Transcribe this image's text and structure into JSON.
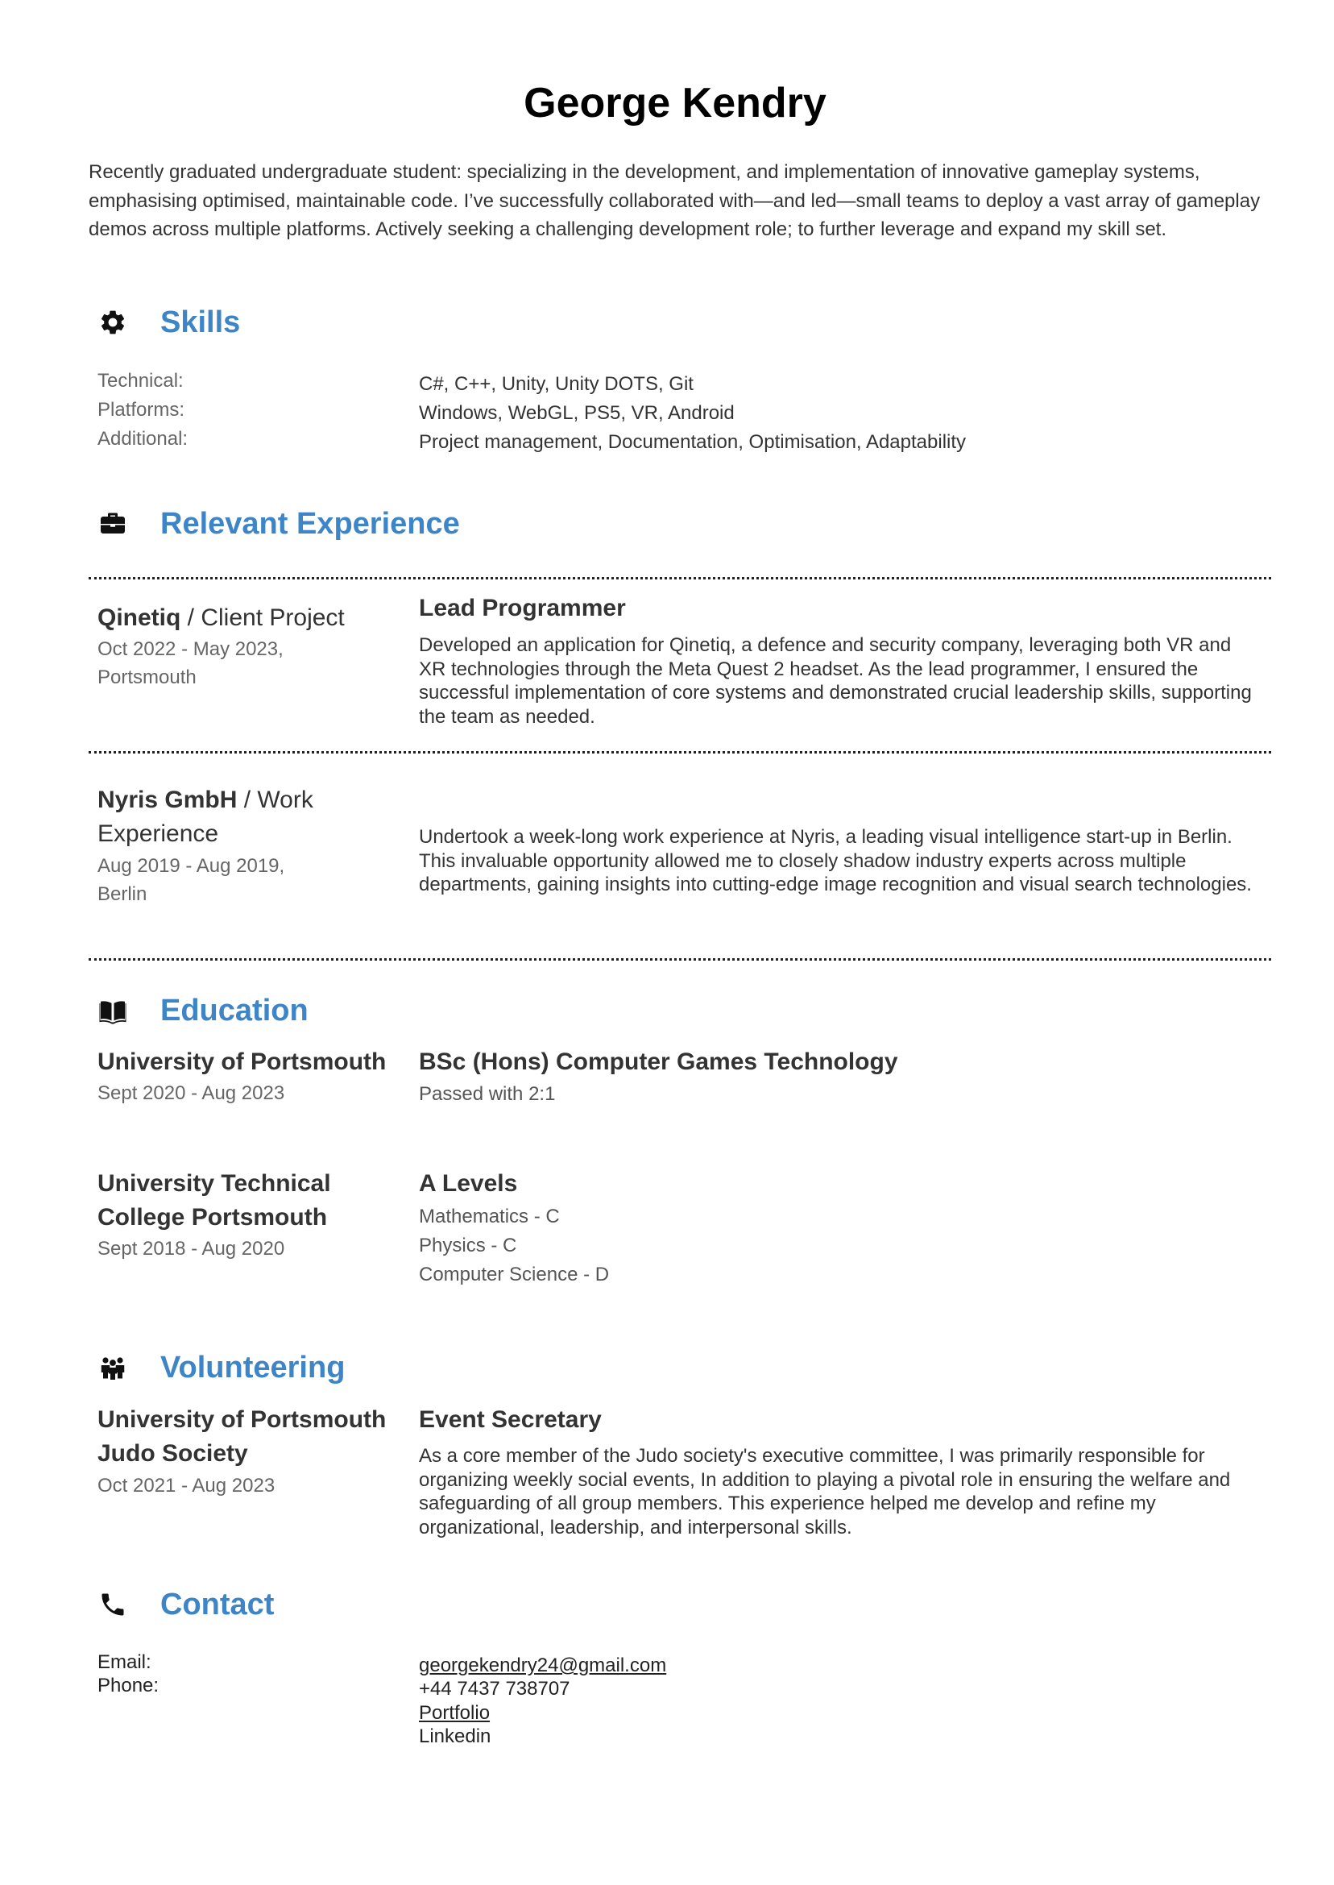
{
  "name": "George Kendry",
  "summary": "Recently graduated undergraduate student: specializing in the development, and implementation of innovative gameplay systems, emphasising optimised, maintainable code. I’ve successfully collaborated with—and led—small teams to deploy a vast array of gameplay demos across multiple platforms. Actively seeking a challenging development role; to further leverage and expand my skill set.",
  "sections": {
    "skills": {
      "title": "Skills",
      "icon": "gear-icon"
    },
    "experience": {
      "title": "Relevant Experience",
      "icon": "briefcase-icon"
    },
    "education": {
      "title": "Education",
      "icon": "book-icon"
    },
    "volunteering": {
      "title": "Volunteering",
      "icon": "people-icon"
    },
    "contact": {
      "title": "Contact",
      "icon": "phone-icon"
    }
  },
  "skills": [
    {
      "label": "Technical:",
      "value": "C#, C++, Unity, Unity DOTS, Git"
    },
    {
      "label": "Platforms:",
      "value": "Windows, WebGL, PS5, VR,  Android"
    },
    {
      "label": "Additional:",
      "value": "Project management, Documentation, Optimisation, Adaptability"
    }
  ],
  "experience": [
    {
      "org": "Qinetiq",
      "type": " / Client Project",
      "dates": "Oct 2022 - May 2023,",
      "location": "Portsmouth",
      "role": "Lead Programmer",
      "desc": "Developed an application for Qinetiq, a defence and security company, leveraging both VR and XR technologies through the Meta Quest 2 headset. As the lead programmer, I ensured the successful implementation of core systems and demonstrated crucial leadership skills, supporting the team as needed."
    },
    {
      "org": "Nyris GmbH",
      "type": " / Work Experience",
      "dates": "Aug 2019 - Aug 2019,",
      "location": "Berlin",
      "role": "",
      "desc": "Undertook a week-long work experience at Nyris, a leading visual intelligence start-up in Berlin. This invaluable opportunity allowed me to closely shadow industry experts across multiple departments, gaining insights into cutting-edge image recognition and visual search technologies."
    }
  ],
  "education": [
    {
      "school": "University of Portsmouth",
      "dates": "Sept 2020 - Aug 2023",
      "degree": "BSc (Hons) Computer Games Technology",
      "details": [
        "Passed with 2:1"
      ]
    },
    {
      "school": "University Technical College Portsmouth",
      "dates": "Sept 2018 - Aug 2020",
      "degree": "A Levels",
      "details": [
        "Mathematics - C",
        "Physics - C",
        "Computer Science - D"
      ]
    }
  ],
  "volunteering": {
    "org": "University of Portsmouth Judo Society",
    "dates": "Oct 2021 - Aug 2023",
    "role": "Event Secretary",
    "desc": "As a core member of the Judo society's executive committee, I was primarily responsible for organizing weekly social events, In addition to playing a pivotal role in ensuring the welfare and safeguarding of all group members. This experience helped me develop and refine my organizational, leadership, and interpersonal skills."
  },
  "contact": {
    "email_label": "Email:",
    "phone_label": "Phone:",
    "email": "georgekendry24@gmail.com",
    "phone": "+44 7437 738707",
    "portfolio": "Portfolio",
    "linkedin": "Linkedin"
  },
  "colors": {
    "accent": "#3d85c6",
    "link": "#1155cc",
    "muted": "#666666",
    "text": "#333333"
  }
}
